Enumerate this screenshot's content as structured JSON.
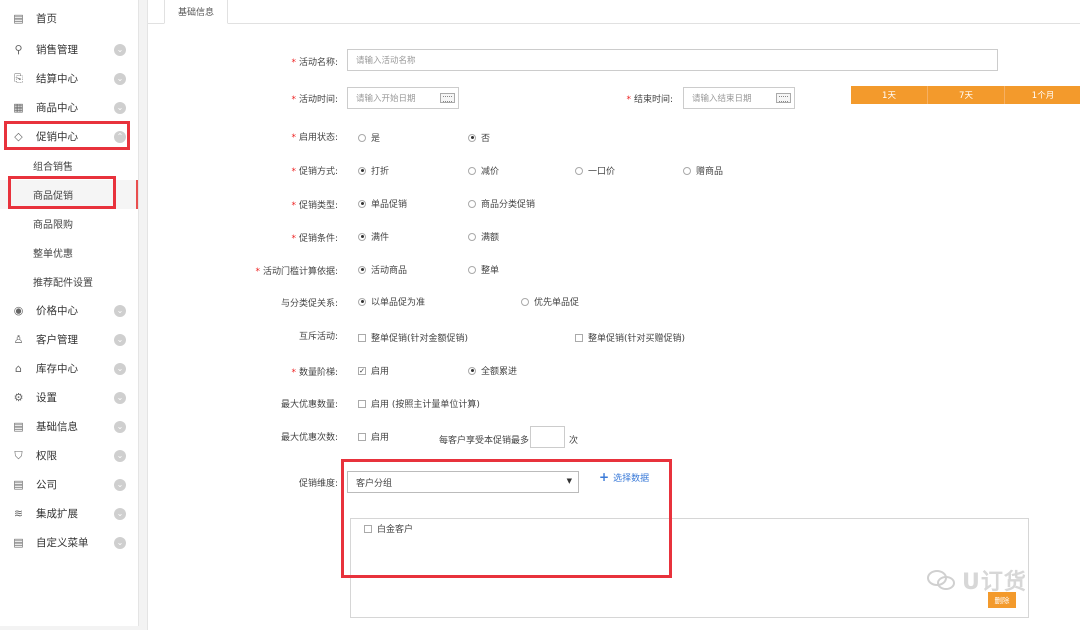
{
  "sidebar": {
    "items": [
      {
        "label": "首页",
        "icon": "home-doc-icon"
      },
      {
        "label": "销售管理",
        "icon": "sales-icon"
      },
      {
        "label": "结算中心",
        "icon": "settlement-icon"
      },
      {
        "label": "商品中心",
        "icon": "grid-icon"
      },
      {
        "label": "促销中心",
        "icon": "tag-icon"
      },
      {
        "label": "价格中心",
        "icon": "price-icon"
      },
      {
        "label": "客户管理",
        "icon": "customer-icon"
      },
      {
        "label": "库存中心",
        "icon": "warehouse-icon"
      },
      {
        "label": "设置",
        "icon": "settings-icon"
      },
      {
        "label": "基础信息",
        "icon": "info-doc-icon"
      },
      {
        "label": "权限",
        "icon": "permission-icon"
      },
      {
        "label": "公司",
        "icon": "company-icon"
      },
      {
        "label": "集成扩展",
        "icon": "layers-icon"
      },
      {
        "label": "自定义菜单",
        "icon": "menu-doc-icon"
      }
    ],
    "sub_items": [
      {
        "label": "组合销售"
      },
      {
        "label": "商品促销"
      },
      {
        "label": "商品限购"
      },
      {
        "label": "整单优惠"
      },
      {
        "label": "推荐配件设置"
      }
    ]
  },
  "tabs": [
    {
      "label": "基础信息"
    }
  ],
  "form": {
    "name": {
      "label": "活动名称:",
      "placeholder": "请输入活动名称"
    },
    "time": {
      "label": "活动时间:",
      "placeholder": "请输入开始日期"
    },
    "end_time": {
      "label": "结束时间:",
      "placeholder": "请输入结束日期"
    },
    "quick_ranges": [
      "1天",
      "7天",
      "1个月"
    ],
    "enable_status": {
      "label": "启用状态:",
      "options": [
        "是",
        "否"
      ],
      "selected": "否"
    },
    "promo_method": {
      "label": "促销方式:",
      "options": [
        "打折",
        "减价",
        "一口价",
        "赠商品"
      ],
      "selected": "打折"
    },
    "promo_type": {
      "label": "促销类型:",
      "options": [
        "单品促销",
        "商品分类促销"
      ],
      "selected": "单品促销"
    },
    "promo_condition": {
      "label": "促销条件:",
      "options": [
        "满件",
        "满额"
      ],
      "selected": "满件"
    },
    "threshold_basis": {
      "label": "活动门槛计算依据:",
      "options": [
        "活动商品",
        "整单"
      ],
      "selected": "活动商品"
    },
    "category_relation": {
      "label": "与分类促关系:",
      "options": [
        "以单品促为准",
        "优先单品促"
      ],
      "selected": "以单品促为准"
    },
    "exclusive": {
      "label": "互斥活动:",
      "options": [
        "整单促销(针对金额促销)",
        "整单促销(针对买赠促销)"
      ]
    },
    "quantity_tier": {
      "label": "数量阶梯:",
      "checkbox": "启用",
      "checked": true,
      "radio": "全额累进"
    },
    "max_discount_qty": {
      "label": "最大优惠数量:",
      "checkbox": "启用 (按照主计量单位计算)"
    },
    "max_discount_times": {
      "label": "最大优惠次数:",
      "checkbox": "启用",
      "per_customer": "每客户享受本促销最多",
      "unit": "次"
    },
    "dimension": {
      "label": "促销维度:",
      "value": "客户分组",
      "add_link": "选择数据"
    },
    "data_rows": [
      {
        "label": "白金客户"
      }
    ],
    "delete_label": "删除"
  },
  "watermark": {
    "text": "U订货"
  },
  "colors": {
    "accent": "#f39a2c",
    "highlight": "#e8323c",
    "link": "#3a7ad8"
  }
}
